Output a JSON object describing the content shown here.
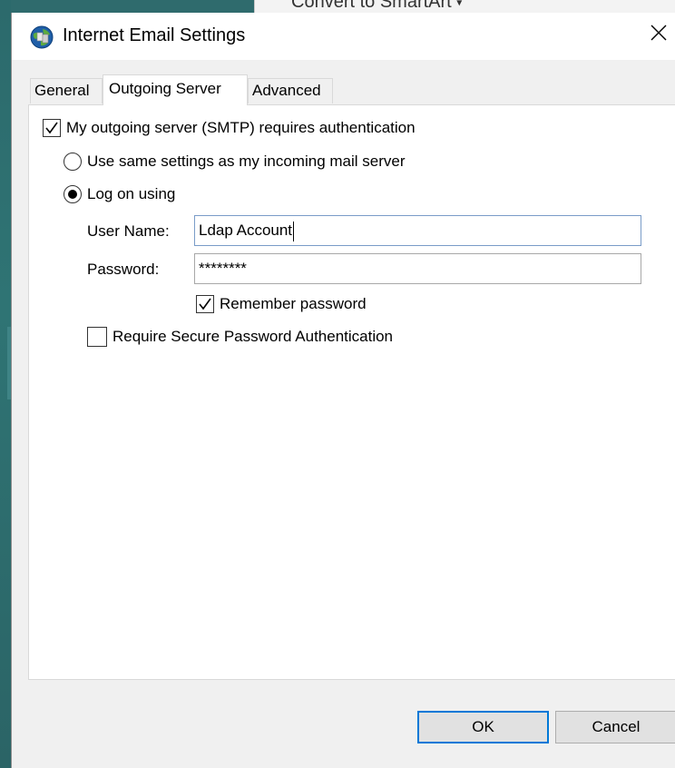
{
  "background_app": {
    "partial_text": "Convert to SmartArt"
  },
  "dialog": {
    "title": "Internet Email Settings",
    "close_glyph": "✕"
  },
  "tabs": [
    {
      "label": "General",
      "active": false
    },
    {
      "label": "Outgoing Server",
      "active": true
    },
    {
      "label": "Advanced",
      "active": false
    }
  ],
  "outgoing": {
    "smtp_auth_label": "My outgoing server (SMTP) requires authentication",
    "smtp_auth_checked": true,
    "same_settings_label": "Use same settings as my incoming mail server",
    "same_settings_selected": false,
    "log_on_label": "Log on using",
    "log_on_selected": true,
    "username_label": "User Name:",
    "username_value": "Ldap Account",
    "password_label": "Password:",
    "password_value": "********",
    "remember_label": "Remember password",
    "remember_checked": true,
    "spa_label": "Require Secure Password Authentication",
    "spa_checked": false
  },
  "buttons": {
    "ok_label": "OK",
    "cancel_label": "Cancel"
  },
  "colors": {
    "desktop": "#2f6b6d",
    "default_button_border": "#0078d7",
    "active_field_border": "#7a9cc8"
  },
  "icons": {
    "app": "outlook-globe-icon",
    "close": "close-icon",
    "check": "checkmark-icon"
  }
}
